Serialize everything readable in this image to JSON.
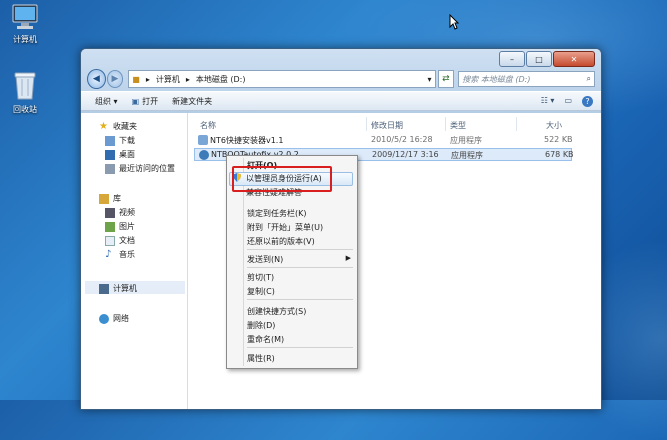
{
  "desktop": {
    "icons": [
      {
        "label": "计算机",
        "icon": "computer-icon"
      },
      {
        "label": "回收站",
        "icon": "recycle-bin-icon"
      }
    ]
  },
  "window": {
    "controls": {
      "minimize": "–",
      "maximize": "□",
      "close": "✕"
    },
    "address": {
      "root": "计算机",
      "separator": "▸",
      "current": "本地磁盘 (D:)"
    },
    "search_placeholder": "搜索 本地磁盘 (D:)",
    "toolbar": {
      "organize": "组织 ▾",
      "open": "打开",
      "new_folder": "新建文件夹"
    },
    "sidebar": {
      "favorites": "收藏夹",
      "fav_items": [
        "下载",
        "桌面",
        "最近访问的位置"
      ],
      "libraries": "库",
      "lib_items": [
        "视频",
        "图片",
        "文档",
        "音乐"
      ],
      "computer": "计算机",
      "network": "网络"
    },
    "columns": {
      "name": "名称",
      "modified": "修改日期",
      "type": "类型",
      "size": "大小"
    },
    "files": [
      {
        "name": "NT6快捷安装器v1.1",
        "modified": "2010/5/2 16:28",
        "type": "应用程序",
        "size": "522 KB"
      },
      {
        "name": "NTBOOTautofix v2.0.2",
        "modified": "2009/12/17 3:16",
        "type": "应用程序",
        "size": "678 KB"
      }
    ]
  },
  "context_menu": {
    "open": "打开(O)",
    "run_as_admin": "以管理员身份运行(A)",
    "compat": "兼容性疑难解答",
    "pin_taskbar": "锁定到任务栏(K)",
    "pin_start": "附到「开始」菜单(U)",
    "restore": "还原以前的版本(V)",
    "send_to": "发送到(N)",
    "cut": "剪切(T)",
    "copy": "复制(C)",
    "shortcut": "创建快捷方式(S)",
    "delete": "删除(D)",
    "rename": "重命名(M)",
    "properties": "属性(R)"
  },
  "colors": {
    "highlight_box": "#d81e1e",
    "selection": "#dceafa",
    "window_frame": "#b4cde7"
  }
}
